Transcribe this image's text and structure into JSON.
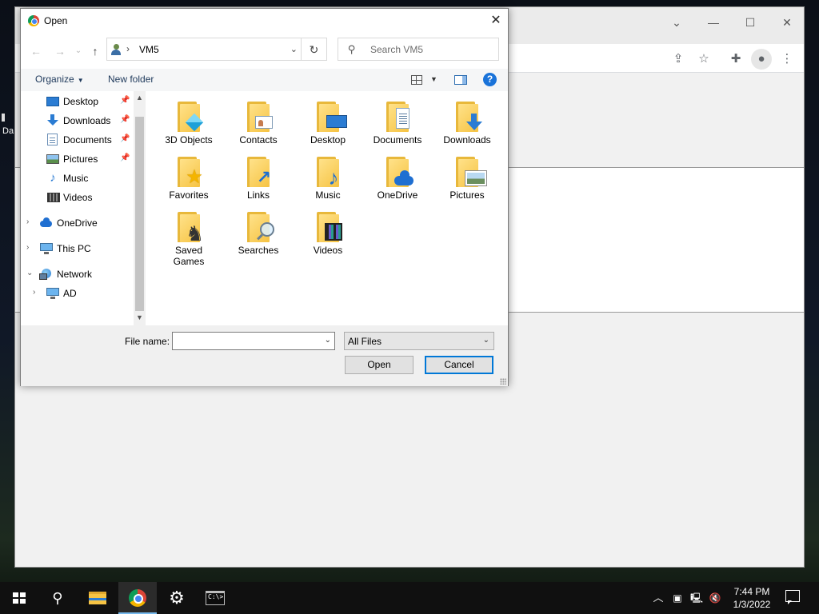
{
  "desktop": {
    "stub_label": "Da"
  },
  "chrome": {
    "window_buttons": {
      "collapse": "⌄",
      "minimize": "—",
      "maximize": "☐",
      "close": "✕"
    },
    "toolbar_icons": [
      "share-icon",
      "star-icon",
      "extensions-icon",
      "profile-icon",
      "menu-icon"
    ]
  },
  "dialog": {
    "title": "Open",
    "close_glyph": "✕",
    "nav": {
      "back": "←",
      "forward": "→",
      "recent": "⌄",
      "up": "↑",
      "breadcrumb_sep": "›",
      "location": "VM5",
      "refresh": "↻",
      "search_placeholder": "Search VM5"
    },
    "commands": {
      "organize": "Organize",
      "new_folder": "New folder",
      "help": "?"
    },
    "nav_pane": [
      {
        "label": "Desktop",
        "icon": "desktop-icon",
        "pinned": true
      },
      {
        "label": "Downloads",
        "icon": "downloads-icon",
        "pinned": true
      },
      {
        "label": "Documents",
        "icon": "documents-icon",
        "pinned": true
      },
      {
        "label": "Pictures",
        "icon": "pictures-icon",
        "pinned": true
      },
      {
        "label": "Music",
        "icon": "music-icon",
        "pinned": false
      },
      {
        "label": "Videos",
        "icon": "videos-icon",
        "pinned": false
      },
      {
        "label": "OneDrive",
        "icon": "onedrive-icon",
        "expander": "›"
      },
      {
        "label": "This PC",
        "icon": "this-pc-icon",
        "expander": "›"
      },
      {
        "label": "Network",
        "icon": "network-icon",
        "expander": "⌄"
      },
      {
        "label": "AD",
        "icon": "computer-icon",
        "expander": "›"
      }
    ],
    "pin_glyph": "📌",
    "files": [
      {
        "name": "3D Objects",
        "icon": "3d-objects-icon"
      },
      {
        "name": "Contacts",
        "icon": "contacts-icon"
      },
      {
        "name": "Desktop",
        "icon": "desktop-folder-icon"
      },
      {
        "name": "Documents",
        "icon": "documents-folder-icon"
      },
      {
        "name": "Downloads",
        "icon": "downloads-folder-icon"
      },
      {
        "name": "Favorites",
        "icon": "favorites-icon"
      },
      {
        "name": "Links",
        "icon": "links-icon"
      },
      {
        "name": "Music",
        "icon": "music-folder-icon"
      },
      {
        "name": "OneDrive",
        "icon": "onedrive-folder-icon"
      },
      {
        "name": "Pictures",
        "icon": "pictures-folder-icon"
      },
      {
        "name": "Saved Games",
        "icon": "saved-games-icon"
      },
      {
        "name": "Searches",
        "icon": "searches-icon"
      },
      {
        "name": "Videos",
        "icon": "videos-folder-icon"
      }
    ],
    "overlay_glyphs": {
      "favorites": "★",
      "links": "↗",
      "music": "♪",
      "saved_games": "♞"
    },
    "file_name_label": "File name:",
    "file_name_value": "",
    "file_type": "All Files",
    "open_label": "Open",
    "cancel_label": "Cancel"
  },
  "taskbar": {
    "apps": [
      "start-button",
      "search-button",
      "file-explorer",
      "chrome",
      "settings",
      "terminal"
    ],
    "search_glyph": "⚲",
    "settings_glyph": "⚙",
    "terminal_glyph": "C:\\>",
    "tray": {
      "chevron": "︿",
      "clock_time": "7:44 PM",
      "clock_date": "1/3/2022"
    }
  },
  "colors": {
    "accent": "#0078d7",
    "taskbar": "#101010",
    "folder": "#f6c343"
  }
}
